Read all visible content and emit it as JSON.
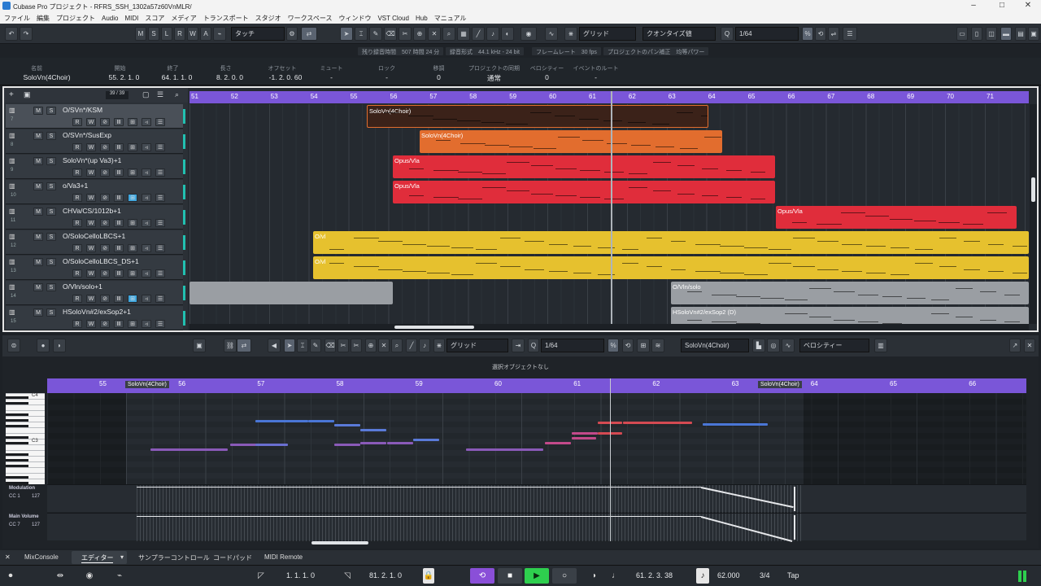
{
  "window": {
    "title": "Cubase Pro プロジェクト - RFRS_SSH_1302a57z60VnMLR/",
    "minimize": "–",
    "maximize": "□",
    "close": "✕"
  },
  "menu": [
    "ファイル",
    "編集",
    "プロジェクト",
    "Audio",
    "MIDI",
    "スコア",
    "メディア",
    "トランスポート",
    "スタジオ",
    "ワークスペース",
    "ウィンドウ",
    "VST Cloud",
    "Hub",
    "マニュアル"
  ],
  "toolbar": {
    "m": "M",
    "s": "S",
    "l": "L",
    "r": "R",
    "w": "W",
    "a": "A",
    "automation_mode": "タッチ",
    "grid_type": "グリッド",
    "quantize_type": "クオンタイズ値",
    "quantize_value": "1/64"
  },
  "status": [
    "残り録音時間　507 時間 24 分",
    "録音形式　44.1 kHz - 24 bit",
    "フレームレート　30 fps",
    "プロジェクトのパン補正　均等パワー"
  ],
  "info_line": {
    "headers": [
      "名前",
      "開始",
      "終了",
      "長さ",
      "オフセット",
      "ミュート",
      "ロック",
      "移調",
      "プロジェクトの同期",
      "ベロシティー",
      "イベントのルート"
    ],
    "values": [
      "SoloVn(4Choir)",
      "55. 2. 1.  0",
      "64. 1. 1.  0",
      "8. 2. 0.  0",
      "-1. 2. 0. 60",
      "-",
      "-",
      "0",
      "通常",
      "0",
      "-"
    ]
  },
  "tracklist": {
    "count": "39 / 39"
  },
  "tracks": [
    {
      "num": "7",
      "name": "O/SVn*/KSM"
    },
    {
      "num": "8",
      "name": "O/SVn*/SusExp"
    },
    {
      "num": "9",
      "name": "SoloVn*(up Va3)+1"
    },
    {
      "num": "10",
      "name": "o/Va3+1"
    },
    {
      "num": "11",
      "name": "CHVa/CS/1012b+1"
    },
    {
      "num": "12",
      "name": "O/SoloCelloLBCS+1"
    },
    {
      "num": "13",
      "name": "O/SoloCelloLBCS_DS+1"
    },
    {
      "num": "14",
      "name": "O/Vln/solo+1"
    },
    {
      "num": "15",
      "name": "HSoloVn#2/exSop2+1"
    }
  ],
  "ruler_bars": [
    "51",
    "52",
    "53",
    "54",
    "55",
    "56",
    "57",
    "58",
    "59",
    "60",
    "61",
    "62",
    "63",
    "64",
    "65",
    "66",
    "67",
    "68",
    "69",
    "70",
    "71"
  ],
  "parts": [
    {
      "label": "SoloVn(4Choir)",
      "color": "#3b2219"
    },
    {
      "label": "SoloVn(4Choir)",
      "color": "#e26d2e"
    },
    {
      "label": "Opus/Vla",
      "color": "#e02d3b"
    },
    {
      "label": "Opus/Vla",
      "color": "#e02d3b"
    },
    {
      "label": "Opus/Vla",
      "color": "#e02d3b"
    },
    {
      "label": "O/vl",
      "color": "#e6c12e"
    },
    {
      "label": "O/vl",
      "color": "#e6c12e"
    },
    {
      "label": "O/Vln/solo",
      "color": "#9a9ea3"
    },
    {
      "label": "HSoloVn#2/exSop2 (D)",
      "color": "#9a9ea3"
    }
  ],
  "editor": {
    "grid_type": "グリッド",
    "quantize_value": "1/64",
    "part_name": "SoloVn(4Choir)",
    "ctrl_lane": "ベロシティー",
    "no_selection": "選択オブジェクトなし",
    "ruler_bars": [
      "55",
      "56",
      "57",
      "58",
      "59",
      "60",
      "61",
      "62",
      "63",
      "64",
      "65",
      "66"
    ],
    "part_start_label": "SoloVn(4Choir)",
    "part_end_label": "SoloVn(4Choir)",
    "piano_labels": [
      "C4",
      "C3"
    ],
    "cc_lanes": [
      {
        "name": "Modulation",
        "cc": "CC 1",
        "max": "127"
      },
      {
        "name": "Main Volume",
        "cc": "CC 7",
        "max": "127"
      }
    ]
  },
  "tabs": [
    "MixConsole",
    "エディター",
    "サンプラーコントロール",
    "コードパッド",
    "MIDI Remote"
  ],
  "transport": {
    "left_locator": "1. 1. 1.  0",
    "right_locator": "81. 2. 1.  0",
    "position": "61. 2. 3. 38",
    "tempo": "62.000",
    "signature": "3/4",
    "tap": "Tap"
  }
}
